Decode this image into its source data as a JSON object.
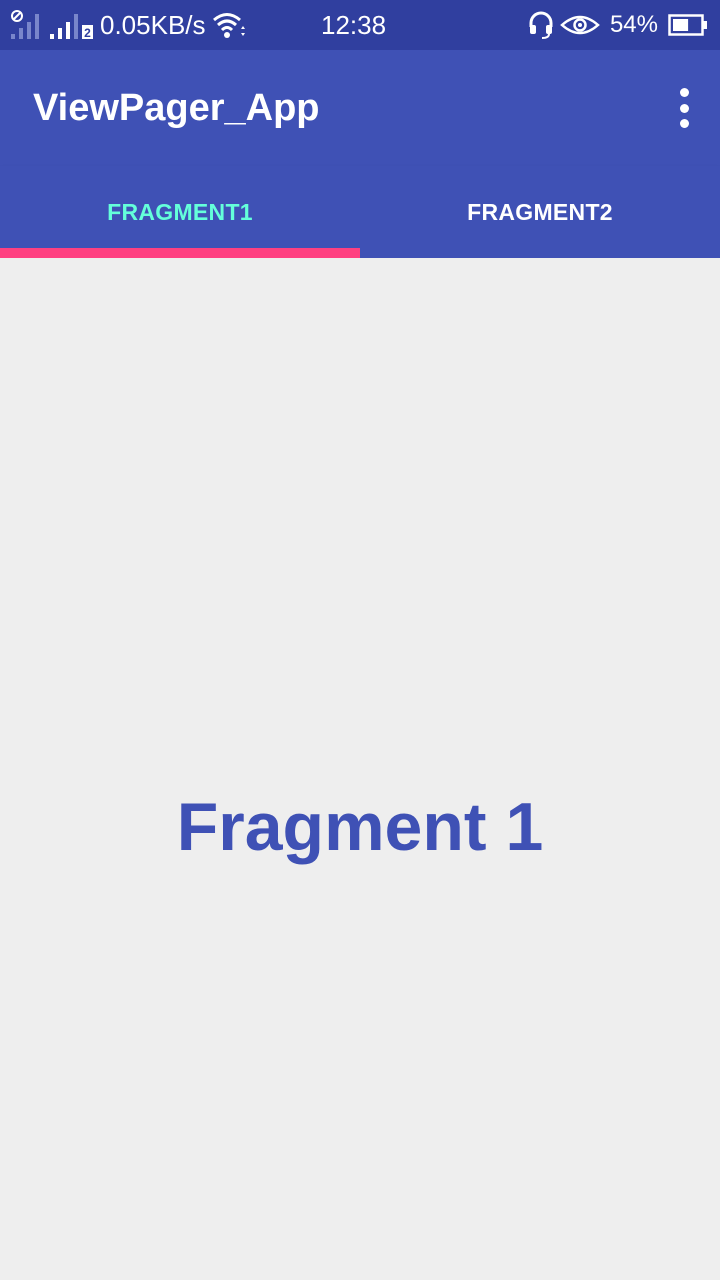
{
  "colors": {
    "status_bar": "#303f9f",
    "primary": "#3f51b5",
    "accent": "#ff4081",
    "selected_tab_text": "#64ffda",
    "background": "#eeeeee"
  },
  "status_bar": {
    "network_speed": "0.05KB/s",
    "sim2_label": "2",
    "time": "12:38",
    "battery_percent": "54%",
    "battery_level": 0.54,
    "icons": [
      "no-sim-icon",
      "signal-icon",
      "signal-sim2-icon",
      "wifi-icon",
      "headset-icon",
      "eye-icon",
      "battery-icon"
    ]
  },
  "toolbar": {
    "title": "ViewPager_App",
    "overflow_icon": "more-vert-icon"
  },
  "tabs": [
    {
      "label": "FRAGMENT1",
      "selected": true
    },
    {
      "label": "FRAGMENT2",
      "selected": false
    }
  ],
  "content": {
    "text": "Fragment 1"
  }
}
